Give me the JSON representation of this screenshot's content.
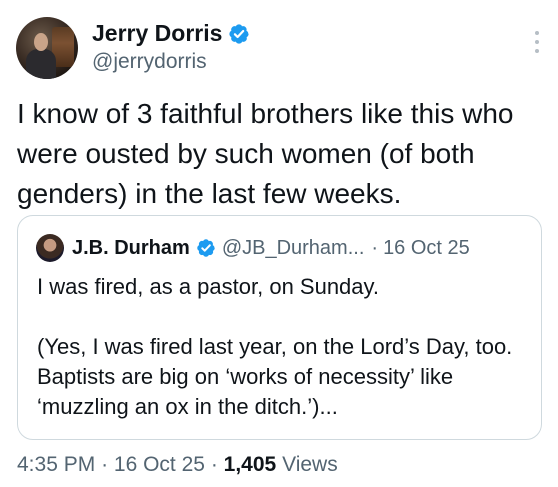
{
  "author": {
    "display_name": "Jerry Dorris",
    "handle": "@jerrydorris",
    "verified": true
  },
  "tweet": {
    "text": "I know of 3 faithful brothers like this who were ousted by such women (of both genders) in the last few weeks."
  },
  "quote": {
    "display_name": "J.B. Durham",
    "handle": "@JB_Durham...",
    "separator": "·",
    "date": "16 Oct 25",
    "paragraph_1": "I was fired, as a pastor, on Sunday.",
    "paragraph_2": "(Yes, I was fired last year, on the Lord’s Day, too. Baptists are big on ‘works of necessity’ like ‘muzzling an ox in the ditch.’)..."
  },
  "meta": {
    "time": "4:35 PM",
    "separator": "·",
    "date": "16 Oct 25",
    "views_count": "1,405",
    "views_label": "Views"
  },
  "colors": {
    "verified_blue": "#1d9bf0",
    "text_primary": "#0f1419",
    "text_secondary": "#536471",
    "border": "#cfd9de"
  },
  "icons": {
    "verified": "verified-badge-icon",
    "more": "more-vertical-icon"
  }
}
